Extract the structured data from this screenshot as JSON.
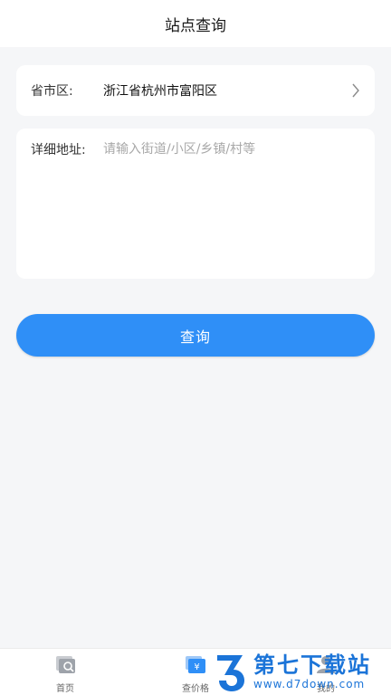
{
  "header": {
    "title": "站点查询"
  },
  "region": {
    "label": "省市区:",
    "value": "浙江省杭州市富阳区"
  },
  "address": {
    "label": "详细地址:",
    "placeholder": "请输入街道/小区/乡镇/村等",
    "value": ""
  },
  "actions": {
    "query_label": "查询"
  },
  "tabbar": {
    "items": [
      {
        "label": "首页",
        "icon": "home-icon"
      },
      {
        "label": "查价格",
        "icon": "price-icon"
      },
      {
        "label": "我的",
        "icon": "profile-icon"
      }
    ],
    "active_color": "#2f8ff7"
  },
  "watermark": {
    "title": "第七下载站",
    "url": "www.d7down.com"
  },
  "colors": {
    "accent": "#2f8ff7",
    "background": "#f5f6f8",
    "watermark": "#1b74d8"
  }
}
